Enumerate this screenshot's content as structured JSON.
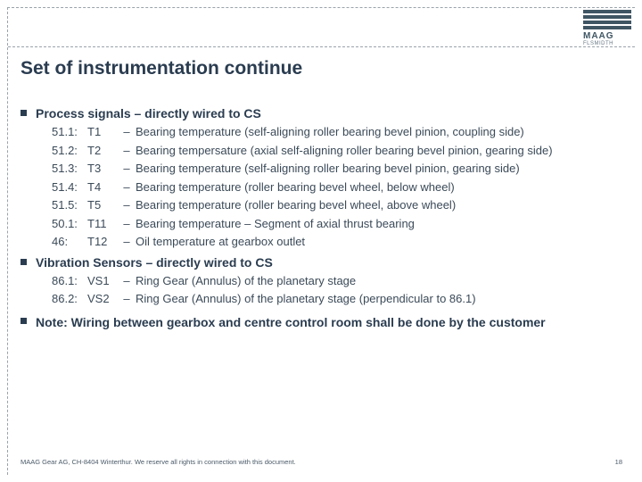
{
  "header": {
    "brand": "MAAG",
    "sub": "FLSMIDTH"
  },
  "title": "Set of instrumentation continue",
  "sections": [
    {
      "heading": "Process signals – directly wired to CS",
      "items": [
        {
          "num": "51.1:",
          "code": "T1",
          "dash": "–",
          "desc": "Bearing temperature (self-aligning roller bearing bevel pinion, coupling side)"
        },
        {
          "num": "51.2:",
          "code": "T2",
          "dash": "–",
          "desc": "Bearing tempersature (axial self-aligning roller bearing bevel pinion, gearing side)"
        },
        {
          "num": "51.3:",
          "code": "T3",
          "dash": "–",
          "desc": "Bearing temperature (self-aligning roller bearing bevel pinion, gearing side)"
        },
        {
          "num": "51.4:",
          "code": "T4",
          "dash": "–",
          "desc": "Bearing temperature (roller bearing bevel wheel, below wheel)"
        },
        {
          "num": "51.5:",
          "code": "T5",
          "dash": "–",
          "desc": "Bearing temperature (roller bearing bevel wheel, above wheel)"
        },
        {
          "num": "50.1:",
          "code": "T11",
          "dash": "–",
          "desc": "Bearing temperature – Segment of axial thrust bearing"
        },
        {
          "num": "46:",
          "code": "T12",
          "dash": "–",
          "desc": "Oil temperature at gearbox outlet"
        }
      ]
    },
    {
      "heading": "Vibration Sensors – directly wired to CS",
      "items": [
        {
          "num": "86.1:",
          "code": "VS1",
          "dash": "–",
          "desc": "Ring Gear (Annulus) of the planetary stage"
        },
        {
          "num": "86.2:",
          "code": "VS2",
          "dash": "–",
          "desc": "Ring Gear (Annulus) of the planetary stage (perpendicular to 86.1)"
        }
      ]
    }
  ],
  "note": "Note: Wiring between gearbox and centre control room shall be done by the customer",
  "footer": {
    "left": "MAAG Gear AG, CH-8404 Winterthur. We reserve all rights in connection with this document.",
    "page": "18"
  }
}
